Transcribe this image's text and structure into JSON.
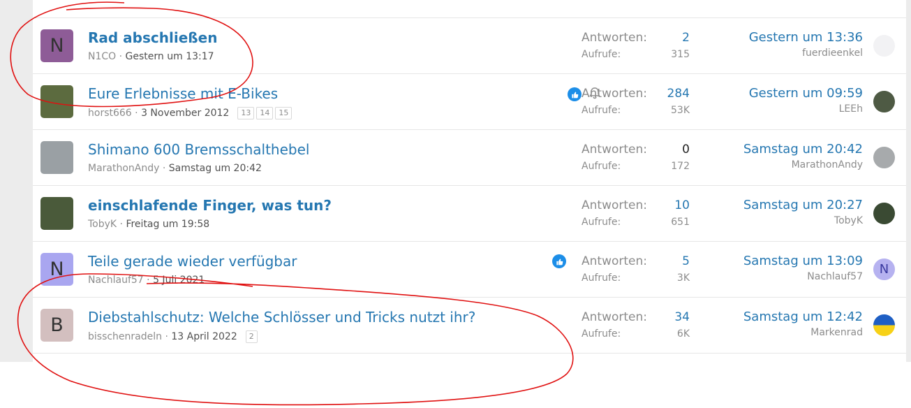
{
  "threads": [
    {
      "title": "Rad abschließen",
      "bold": true,
      "author": "N1CO",
      "date": "Gestern um 13:17",
      "pages": [],
      "liked": false,
      "watched": false,
      "replies_label": "Antworten:",
      "replies": "2",
      "views_label": "Aufrufe:",
      "views": "315",
      "last_time": "Gestern um 13:36",
      "last_user": "fuerdieenkel",
      "avatar_letter": "N",
      "avatar_bg": "#8e5c97"
    },
    {
      "title": "Eure Erlebnisse mit E-Bikes",
      "bold": false,
      "author": "horst666",
      "date": "3 November 2012",
      "pages": [
        "13",
        "14",
        "15"
      ],
      "liked": true,
      "watched": true,
      "replies_label": "Antworten:",
      "replies": "284",
      "views_label": "Aufrufe:",
      "views": "53K",
      "last_time": "Gestern um 09:59",
      "last_user": "LEEh",
      "avatar_letter": "",
      "avatar_bg": "#5c6b3f"
    },
    {
      "title": "Shimano 600 Bremsschalthebel",
      "bold": false,
      "author": "MarathonAndy",
      "date": "Samstag um 20:42",
      "pages": [],
      "liked": false,
      "watched": false,
      "replies_label": "Antworten:",
      "replies": "0",
      "views_label": "Aufrufe:",
      "views": "172",
      "last_time": "Samstag um 20:42",
      "last_user": "MarathonAndy",
      "avatar_letter": "",
      "avatar_bg": "#9aa0a4"
    },
    {
      "title": "einschlafende Finger, was tun?",
      "bold": true,
      "author": "TobyK",
      "date": "Freitag um 19:58",
      "pages": [],
      "liked": false,
      "watched": false,
      "replies_label": "Antworten:",
      "replies": "10",
      "views_label": "Aufrufe:",
      "views": "651",
      "last_time": "Samstag um 20:27",
      "last_user": "TobyK",
      "avatar_letter": "",
      "avatar_bg": "#4a5a3a"
    },
    {
      "title": "Teile gerade wieder verfügbar",
      "bold": false,
      "author": "Nachlauf57",
      "date": "5 Juli 2021",
      "pages": [],
      "liked": true,
      "watched": false,
      "replies_label": "Antworten:",
      "replies": "5",
      "views_label": "Aufrufe:",
      "views": "3K",
      "last_time": "Samstag um 13:09",
      "last_user": "Nachlauf57",
      "avatar_letter": "N",
      "avatar_bg": "#a9a6f0"
    },
    {
      "title": "Diebstahlschutz: Welche Schlösser und Tricks nutzt ihr?",
      "bold": false,
      "author": "bisschenradeln",
      "date": "13 April 2022",
      "pages": [
        "2"
      ],
      "liked": false,
      "watched": false,
      "replies_label": "Antworten:",
      "replies": "34",
      "views_label": "Aufrufe:",
      "views": "6K",
      "last_time": "Samstag um 12:42",
      "last_user": "Markenrad",
      "avatar_letter": "B",
      "avatar_bg": "#d3bfbf"
    }
  ],
  "colors": {
    "link": "#2577b1",
    "annotation": "#e01010"
  }
}
